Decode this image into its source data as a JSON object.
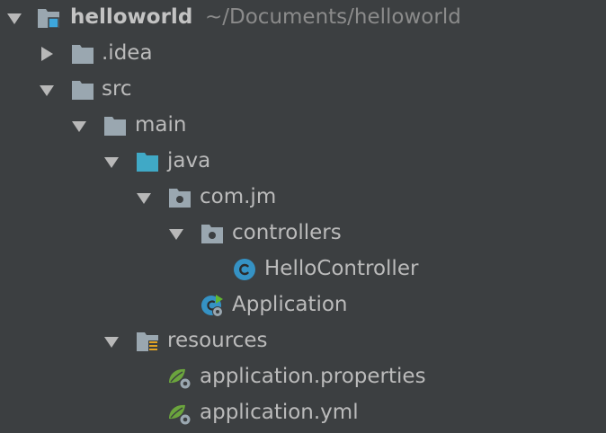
{
  "project": {
    "name": "helloworld",
    "path": "~/Documents/helloworld"
  },
  "tree": {
    "idea": ".idea",
    "src": "src",
    "main": "main",
    "java": "java",
    "package": "com.jm",
    "controllers": "controllers",
    "hello_controller": "HelloController",
    "application": "Application",
    "resources": "resources",
    "app_properties": "application.properties",
    "app_yml": "application.yml"
  },
  "colors": {
    "background": "#3c3f41",
    "text": "#bbbbbb",
    "path_text": "#8b8b8b",
    "folder": "#9aa7b0",
    "source_folder": "#40a9c6",
    "class_icon": "#3592c4",
    "spring_green": "#6ba53d"
  }
}
